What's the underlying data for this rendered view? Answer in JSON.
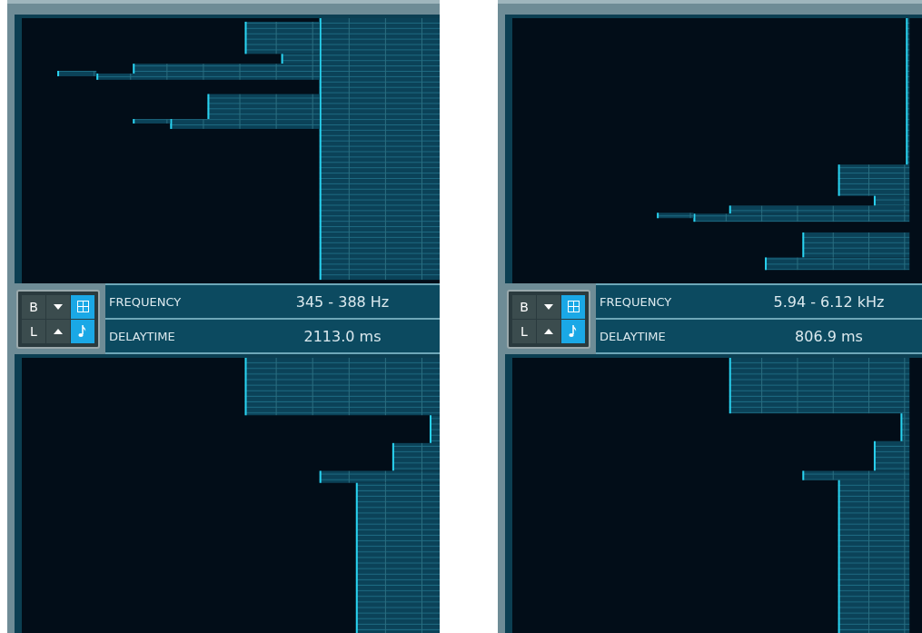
{
  "panels": [
    {
      "frequency": {
        "label": "FREQUENCY",
        "value": "345 - 388 Hz"
      },
      "delay": {
        "label": "DELAYTIME",
        "value": "2113.0 ms"
      },
      "buttons": [
        {
          "kind": "text",
          "label": "B",
          "selected": false
        },
        {
          "kind": "down",
          "selected": false
        },
        {
          "kind": "grid",
          "selected": true
        },
        {
          "kind": "text",
          "label": "L",
          "selected": false
        },
        {
          "kind": "up",
          "selected": false
        },
        {
          "kind": "note",
          "selected": true
        }
      ]
    },
    {
      "frequency": {
        "label": "FREQUENCY",
        "value": "5.94 - 6.12 kHz"
      },
      "delay": {
        "label": "DELAYTIME",
        "value": "806.9 ms"
      },
      "buttons": [
        {
          "kind": "text",
          "label": "B",
          "selected": false
        },
        {
          "kind": "down",
          "selected": false
        },
        {
          "kind": "grid",
          "selected": true
        },
        {
          "kind": "text",
          "label": "L",
          "selected": false
        },
        {
          "kind": "up",
          "selected": false
        },
        {
          "kind": "note",
          "selected": true
        }
      ]
    }
  ]
}
